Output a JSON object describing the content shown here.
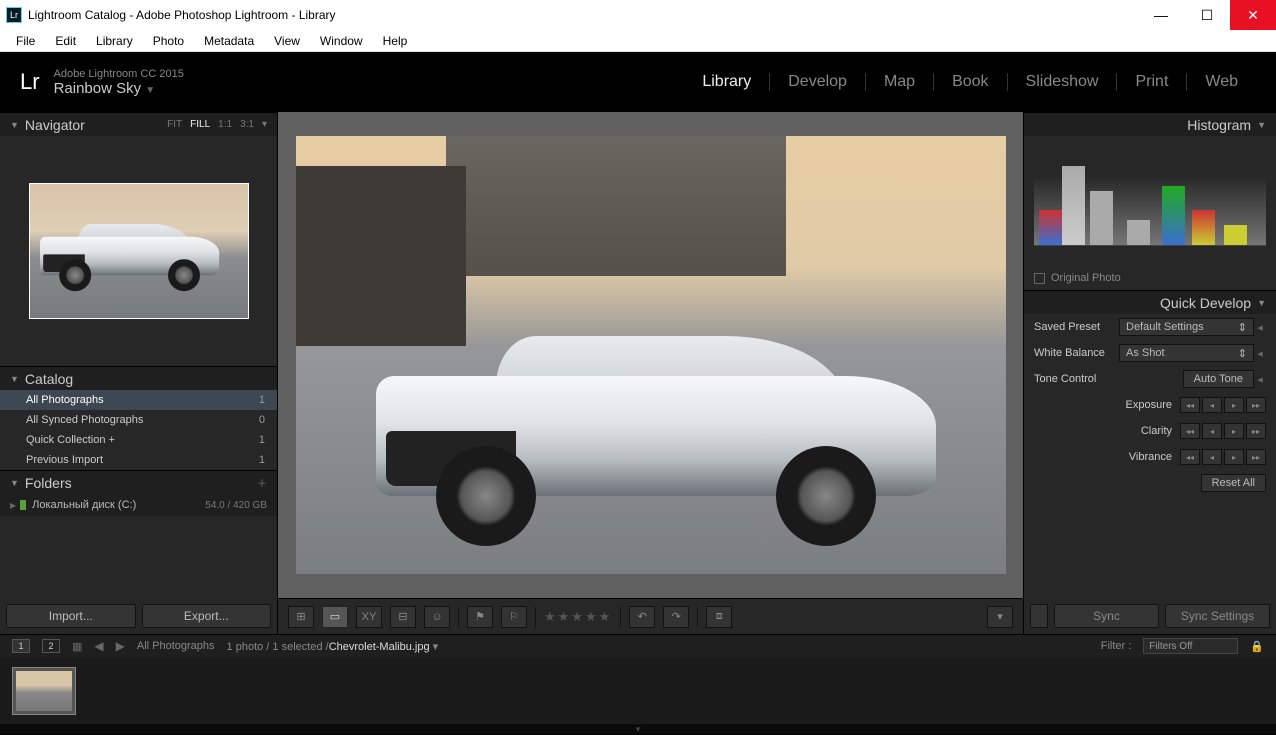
{
  "window": {
    "title": "Lightroom Catalog - Adobe Photoshop Lightroom - Library",
    "app_icon_text": "Lr"
  },
  "menu": [
    "File",
    "Edit",
    "Library",
    "Photo",
    "Metadata",
    "View",
    "Window",
    "Help"
  ],
  "identity": {
    "product": "Adobe Lightroom CC 2015",
    "catalog": "Rainbow Sky",
    "mark": "Lr"
  },
  "modules": [
    "Library",
    "Develop",
    "Map",
    "Book",
    "Slideshow",
    "Print",
    "Web"
  ],
  "active_module": "Library",
  "navigator": {
    "title": "Navigator",
    "zoom": [
      "FIT",
      "FILL",
      "1:1",
      "3:1"
    ],
    "zoom_active": "FILL"
  },
  "catalog": {
    "title": "Catalog",
    "items": [
      {
        "label": "All Photographs",
        "count": "1",
        "selected": true
      },
      {
        "label": "All Synced Photographs",
        "count": "0"
      },
      {
        "label": "Quick Collection  +",
        "count": "1"
      },
      {
        "label": "Previous Import",
        "count": "1"
      }
    ]
  },
  "folders": {
    "title": "Folders",
    "drive": "Локальный диск (C:)",
    "capacity": "54.0 / 420 GB"
  },
  "buttons": {
    "import": "Import...",
    "export": "Export..."
  },
  "histogram": {
    "title": "Histogram",
    "original": "Original Photo"
  },
  "quick_develop": {
    "title": "Quick Develop",
    "rows": [
      {
        "label": "Saved Preset",
        "value": "Default Settings",
        "type": "select"
      },
      {
        "label": "White Balance",
        "value": "As Shot",
        "type": "select"
      },
      {
        "label": "Tone Control",
        "value": "Auto Tone",
        "type": "button"
      }
    ],
    "sliders": [
      "Exposure",
      "Clarity",
      "Vibrance"
    ],
    "reset": "Reset All"
  },
  "sync": {
    "sync": "Sync",
    "settings": "Sync Settings"
  },
  "toolbar_icons": [
    "grid-icon",
    "loupe-icon",
    "compare-icon",
    "survey-icon",
    "people-icon",
    "flag-icon",
    "reject-icon",
    "stars",
    "rotate-left-icon",
    "rotate-right-icon",
    "crop-icon"
  ],
  "filmstrip": {
    "screen1": "1",
    "screen2": "2",
    "breadcrumb": "All Photographs",
    "count": "1 photo / 1 selected /",
    "filename": "Chevrolet-Malibu.jpg",
    "filter_label": "Filter :",
    "filter_value": "Filters Off"
  }
}
